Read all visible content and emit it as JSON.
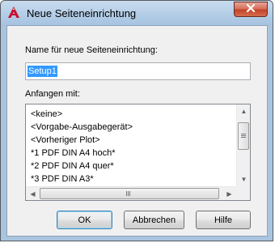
{
  "window": {
    "title": "Neue Seiteneinrichtung"
  },
  "icons": {
    "app_icon": "autocad-a-icon",
    "close_icon": "close-x-icon"
  },
  "name_section": {
    "label": "Name für neue Seiteneinrichtung:",
    "input_value": "Setup1"
  },
  "start_section": {
    "label": "Anfangen mit:",
    "items": [
      "<keine>",
      "<Vorgabe-Ausgabegerät>",
      "<Vorheriger Plot>",
      "*1 PDF DIN A4 hoch*",
      "*2 PDF DIN A4 quer*",
      "*3 PDF DIN A3*"
    ]
  },
  "buttons": {
    "ok": "OK",
    "cancel": "Abbrechen",
    "help": "Hilfe"
  },
  "colors": {
    "selection": "#3399ff",
    "close_button": "#c4432a",
    "frame": "#a9c4df"
  }
}
